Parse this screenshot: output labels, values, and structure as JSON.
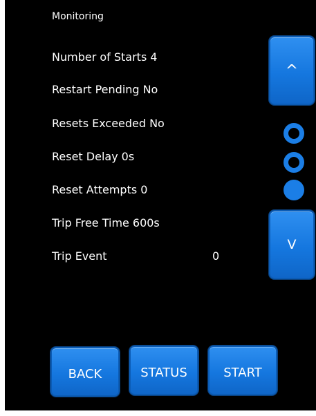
{
  "screen": {
    "title": "Monitoring"
  },
  "rows": [
    {
      "label": "Number of Starts",
      "value": "4"
    },
    {
      "label": "Restart Pending",
      "value": "No"
    },
    {
      "label": "Resets Exceeded",
      "value": "No"
    },
    {
      "label": "Reset Delay",
      "value": "0s"
    },
    {
      "label": "Reset Attempts",
      "value": "0"
    },
    {
      "label": "Trip Free Time",
      "value": "600s"
    },
    {
      "label": "Trip Event",
      "value": "0"
    }
  ],
  "scroll": {
    "up_label": "^",
    "down_label": "V",
    "page_indicator": {
      "pages": 3,
      "current_page": 3
    }
  },
  "buttons": {
    "back_label": "BACK",
    "status_label": "STATUS",
    "start_label": "START"
  },
  "colors": {
    "background": "#000000",
    "accent": "#1b7ee6",
    "text": "#ffffff"
  }
}
